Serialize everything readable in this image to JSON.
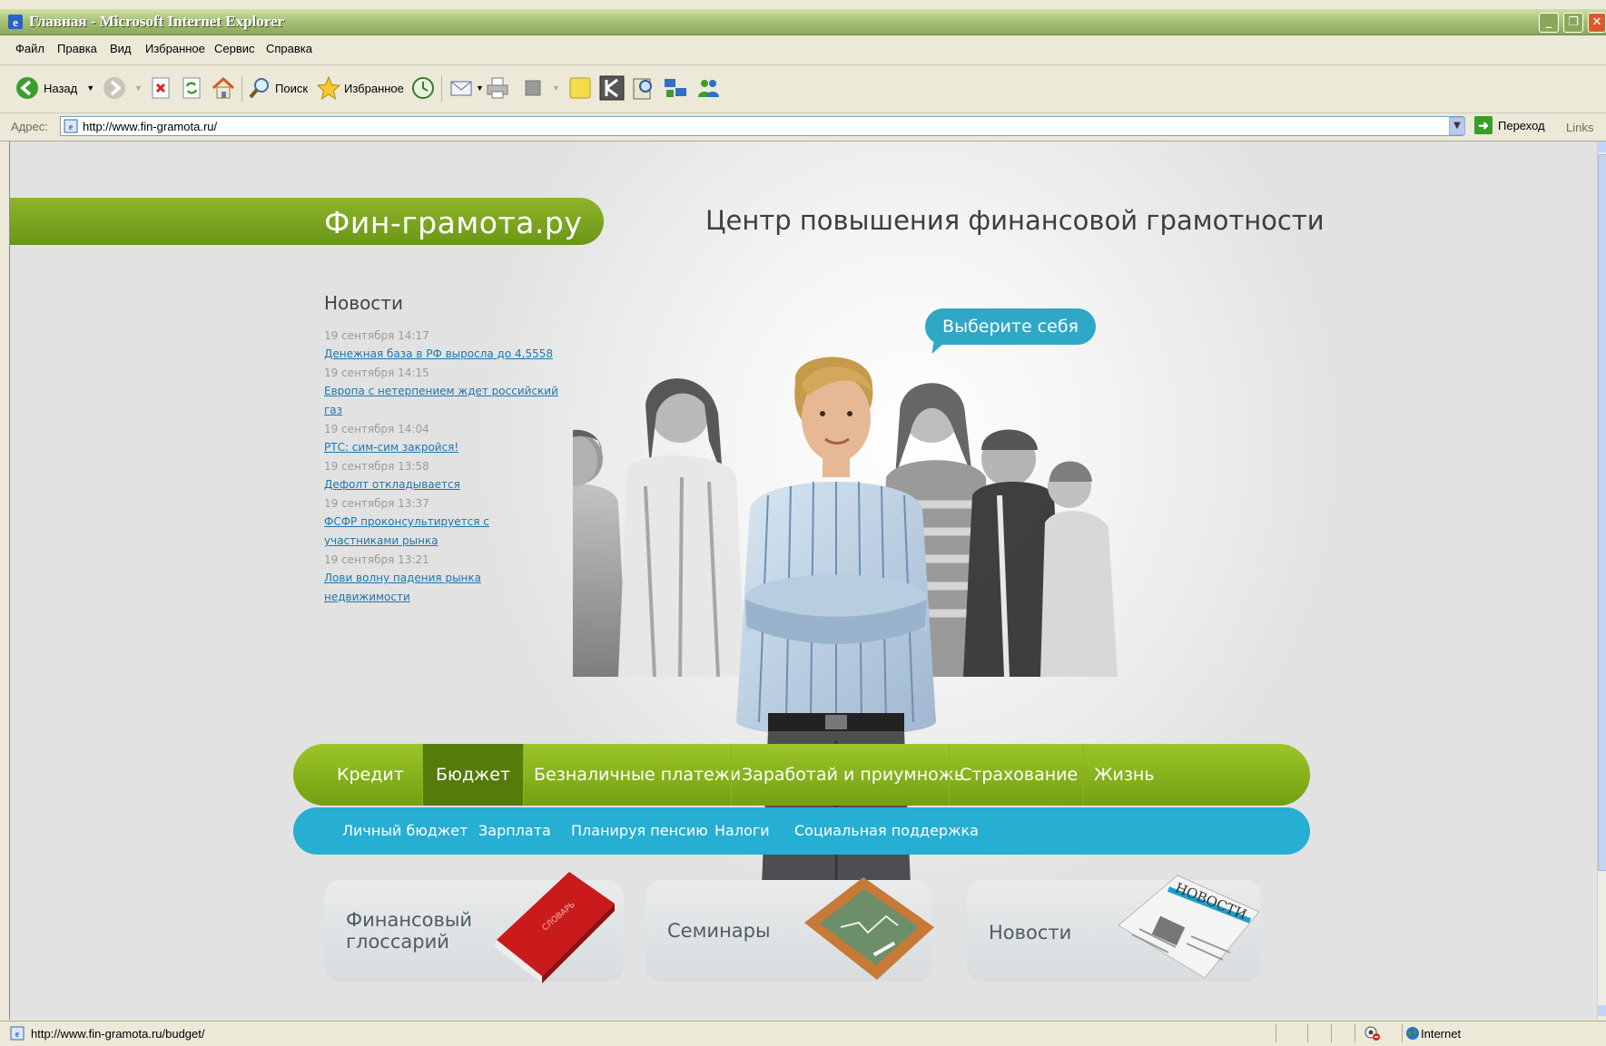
{
  "window": {
    "title": "Главная - Microsoft Internet Explorer"
  },
  "menubar": {
    "items": [
      "Файл",
      "Правка",
      "Вид",
      "Избранное",
      "Сервис",
      "Справка"
    ]
  },
  "toolbar": {
    "back_label": "Назад",
    "search_label": "Поиск",
    "favorites_label": "Избранное"
  },
  "addressbar": {
    "label": "Адрес:",
    "url": "http://www.fin-gramota.ru/",
    "go_label": "Переход",
    "links_label": "Links"
  },
  "page": {
    "logo": "Фин-грамота.ру",
    "tagline": "Центр повышения финансовой грамотности",
    "bubble": "Выберите себя",
    "news": {
      "heading": "Новости",
      "items": [
        {
          "date": "19 сентября 14:17",
          "title": "Денежная база в РФ выросла до 4,5558"
        },
        {
          "date": "19 сентября 14:15",
          "title": "Европа с нетерпением ждет российский газ"
        },
        {
          "date": "19 сентября 14:04",
          "title": "РТС: сим-сим закройся!"
        },
        {
          "date": "19 сентября 13:58",
          "title": "Дефолт откладывается"
        },
        {
          "date": "19 сентября 13:37",
          "title": "ФСФР проконсультируется с участниками рынка"
        },
        {
          "date": "19 сентября 13:21",
          "title": "Лови волну падения рынка недвижимости"
        }
      ]
    },
    "nav": {
      "items": [
        "Кредит",
        "Бюджет",
        "Безналичные платежи",
        "Заработай и приумножь",
        "Страхование",
        "Жизнь"
      ],
      "active": "Бюджет"
    },
    "subnav": {
      "items": [
        "Личный бюджет",
        "Зарплата",
        "Планируя пенсию",
        "Налоги",
        "Социальная поддержка"
      ]
    },
    "tiles": {
      "glossary_line1": "Финансовый",
      "glossary_line2": "глоссарий",
      "book_text": "СЛОВАРЬ",
      "seminars": "Семинары",
      "news": "Новости",
      "newspaper_text": "НОВОСТИ"
    }
  },
  "statusbar": {
    "url": "http://www.fin-gramota.ru/budget/",
    "zone": "Internet"
  },
  "colors": {
    "brand_green": "#7aa51c",
    "active_green": "#557b0b",
    "brand_blue": "#26aed3",
    "link_blue": "#1d77ad"
  }
}
